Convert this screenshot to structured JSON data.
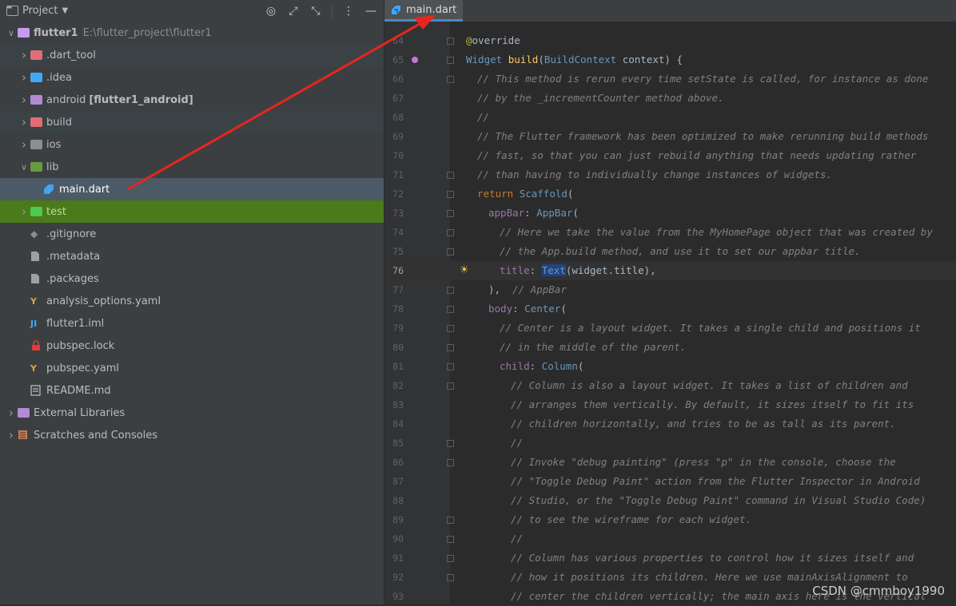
{
  "sidebar": {
    "title": "Project",
    "tree": [
      {
        "label": "flutter1",
        "path": "E:\\flutter_project\\flutter1",
        "bold": true,
        "indent": 0,
        "arrow": "v",
        "icon": "module-folder-icon",
        "color": "#c79cf0"
      },
      {
        "label": ".dart_tool",
        "indent": 1,
        "arrow": ">",
        "icon": "folder-icon",
        "color": "#e06c75"
      },
      {
        "label": ".idea",
        "indent": 1,
        "arrow": ">",
        "icon": "folder-icon",
        "color": "#3fa9f5"
      },
      {
        "label": "android",
        "module": "[flutter1_android]",
        "indent": 1,
        "arrow": ">",
        "icon": "folder-icon",
        "color": "#b38ad6"
      },
      {
        "label": "build",
        "indent": 1,
        "arrow": ">",
        "icon": "folder-icon",
        "color": "#e06c75"
      },
      {
        "label": "ios",
        "indent": 1,
        "arrow": ">",
        "icon": "folder-icon",
        "color": "#8a8f93"
      },
      {
        "label": "lib",
        "indent": 1,
        "arrow": "v",
        "icon": "folder-icon",
        "color": "#6a9b3c"
      },
      {
        "label": "main.dart",
        "indent": 2,
        "arrow": "",
        "icon": "dart-file-icon",
        "color": "#42a5f5",
        "selected": true
      },
      {
        "label": "test",
        "indent": 1,
        "arrow": ">",
        "icon": "folder-icon",
        "color": "#4ec94e",
        "highlight": true
      },
      {
        "label": ".gitignore",
        "indent": 1,
        "arrow": "",
        "icon": "git-file-icon",
        "color": "#8a8f93"
      },
      {
        "label": ".metadata",
        "indent": 1,
        "arrow": "",
        "icon": "text-file-icon",
        "color": "#9aa0a4"
      },
      {
        "label": ".packages",
        "indent": 1,
        "arrow": "",
        "icon": "text-file-icon",
        "color": "#9aa0a4"
      },
      {
        "label": "analysis_options.yaml",
        "indent": 1,
        "arrow": "",
        "icon": "yaml-file-icon",
        "color": "#d9a441"
      },
      {
        "label": "flutter1.iml",
        "indent": 1,
        "arrow": "",
        "icon": "iml-file-icon",
        "color": "#3fa9f5"
      },
      {
        "label": "pubspec.lock",
        "indent": 1,
        "arrow": "",
        "icon": "lock-icon",
        "color": "#e03c3c"
      },
      {
        "label": "pubspec.yaml",
        "indent": 1,
        "arrow": "",
        "icon": "yaml-file-icon",
        "color": "#d9a441"
      },
      {
        "label": "README.md",
        "indent": 1,
        "arrow": "",
        "icon": "markdown-file-icon",
        "color": "#dcdcdc"
      },
      {
        "label": "External Libraries",
        "indent": 0,
        "arrow": ">",
        "icon": "library-icon",
        "color": "#b38ad6"
      },
      {
        "label": "Scratches and Consoles",
        "indent": 0,
        "arrow": ">",
        "icon": "scratches-icon",
        "color": "#c47a52"
      }
    ]
  },
  "editor": {
    "tab_label": "main.dart",
    "current_line": 76,
    "lines": [
      {
        "n": "64",
        "indent": 0,
        "parts": [
          [
            "ann",
            "@"
          ],
          [
            "plain",
            "override"
          ]
        ]
      },
      {
        "n": "65",
        "indent": 0,
        "parts": [
          [
            "cls",
            "Widget "
          ],
          [
            "typ",
            "build"
          ],
          [
            "plain",
            "("
          ],
          [
            "cls",
            "BuildContext "
          ],
          [
            "prm",
            "context"
          ],
          [
            "plain",
            ") {"
          ]
        ]
      },
      {
        "n": "66",
        "indent": 1,
        "parts": [
          [
            "cmt",
            "// This method is rerun every time setState is called, for instance as done"
          ]
        ]
      },
      {
        "n": "67",
        "indent": 1,
        "parts": [
          [
            "cmt",
            "// by the _incrementCounter method above."
          ]
        ]
      },
      {
        "n": "68",
        "indent": 1,
        "parts": [
          [
            "cmt",
            "//"
          ]
        ]
      },
      {
        "n": "69",
        "indent": 1,
        "parts": [
          [
            "cmt",
            "// The Flutter framework has been optimized to make rerunning build methods"
          ]
        ]
      },
      {
        "n": "70",
        "indent": 1,
        "parts": [
          [
            "cmt",
            "// fast, so that you can just rebuild anything that needs updating rather"
          ]
        ]
      },
      {
        "n": "71",
        "indent": 1,
        "parts": [
          [
            "cmt",
            "// than having to individually change instances of widgets."
          ]
        ]
      },
      {
        "n": "72",
        "indent": 1,
        "parts": [
          [
            "kw",
            "return "
          ],
          [
            "cls",
            "Scaffold"
          ],
          [
            "plain",
            "("
          ]
        ]
      },
      {
        "n": "73",
        "indent": 2,
        "parts": [
          [
            "named",
            "appBar"
          ],
          [
            "plain",
            ": "
          ],
          [
            "cls",
            "AppBar"
          ],
          [
            "plain",
            "("
          ]
        ]
      },
      {
        "n": "74",
        "indent": 3,
        "parts": [
          [
            "cmt",
            "// Here we take the value from the MyHomePage object that was created by"
          ]
        ]
      },
      {
        "n": "75",
        "indent": 3,
        "parts": [
          [
            "cmt",
            "// the App.build method, and use it to set our appbar title."
          ]
        ]
      },
      {
        "n": "76",
        "indent": 3,
        "parts": [
          [
            "named",
            "title"
          ],
          [
            "plain",
            ": "
          ],
          [
            "cls",
            "Text"
          ],
          [
            "plain",
            "(widget.title),"
          ]
        ]
      },
      {
        "n": "77",
        "indent": 2,
        "parts": [
          [
            "plain",
            "),  "
          ],
          [
            "cmt",
            "// AppBar"
          ]
        ]
      },
      {
        "n": "78",
        "indent": 2,
        "parts": [
          [
            "named",
            "body"
          ],
          [
            "plain",
            ": "
          ],
          [
            "cls",
            "Center"
          ],
          [
            "plain",
            "("
          ]
        ]
      },
      {
        "n": "79",
        "indent": 3,
        "parts": [
          [
            "cmt",
            "// Center is a layout widget. It takes a single child and positions it"
          ]
        ]
      },
      {
        "n": "80",
        "indent": 3,
        "parts": [
          [
            "cmt",
            "// in the middle of the parent."
          ]
        ]
      },
      {
        "n": "81",
        "indent": 3,
        "parts": [
          [
            "named",
            "child"
          ],
          [
            "plain",
            ": "
          ],
          [
            "cls",
            "Column"
          ],
          [
            "plain",
            "("
          ]
        ]
      },
      {
        "n": "82",
        "indent": 4,
        "parts": [
          [
            "cmt",
            "// Column is also a layout widget. It takes a list of children and"
          ]
        ]
      },
      {
        "n": "83",
        "indent": 4,
        "parts": [
          [
            "cmt",
            "// arranges them vertically. By default, it sizes itself to fit its"
          ]
        ]
      },
      {
        "n": "84",
        "indent": 4,
        "parts": [
          [
            "cmt",
            "// children horizontally, and tries to be as tall as its parent."
          ]
        ]
      },
      {
        "n": "85",
        "indent": 4,
        "parts": [
          [
            "cmt",
            "//"
          ]
        ]
      },
      {
        "n": "86",
        "indent": 4,
        "parts": [
          [
            "cmt",
            "// Invoke \"debug painting\" (press \"p\" in the console, choose the"
          ]
        ]
      },
      {
        "n": "87",
        "indent": 4,
        "parts": [
          [
            "cmt",
            "// \"Toggle Debug Paint\" action from the Flutter Inspector in Android"
          ]
        ]
      },
      {
        "n": "88",
        "indent": 4,
        "parts": [
          [
            "cmt",
            "// Studio, or the \"Toggle Debug Paint\" command in Visual Studio Code)"
          ]
        ]
      },
      {
        "n": "89",
        "indent": 4,
        "parts": [
          [
            "cmt",
            "// to see the wireframe for each widget."
          ]
        ]
      },
      {
        "n": "90",
        "indent": 4,
        "parts": [
          [
            "cmt",
            "//"
          ]
        ]
      },
      {
        "n": "91",
        "indent": 4,
        "parts": [
          [
            "cmt",
            "// Column has various properties to control how it sizes itself and"
          ]
        ]
      },
      {
        "n": "92",
        "indent": 4,
        "parts": [
          [
            "cmt",
            "// how it positions its children. Here we use mainAxisAlignment to"
          ]
        ]
      },
      {
        "n": "93",
        "indent": 4,
        "parts": [
          [
            "cmt",
            "// center the children vertically; the main axis here is the vertical"
          ]
        ]
      }
    ]
  },
  "watermark": "CSDN @cmmboy1990",
  "colors": {
    "accent": "#4a88c7",
    "selection": "#4b5a66",
    "highlight": "#4a7a1a",
    "arrow": "#e8251f"
  }
}
